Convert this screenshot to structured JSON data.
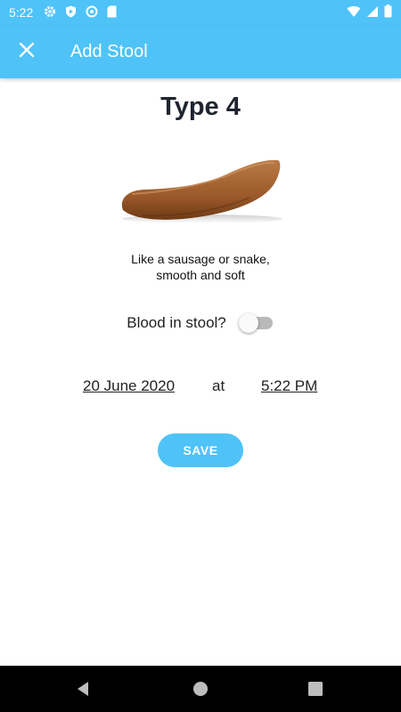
{
  "status_bar": {
    "time": "5:22",
    "icons_left": [
      "settings-icon",
      "play-protect-icon",
      "at-sign-icon",
      "sd-card-icon"
    ],
    "icons_right": [
      "wifi-icon",
      "signal-icon",
      "battery-icon"
    ]
  },
  "app_bar": {
    "title": "Add Stool",
    "close_icon": "close-icon"
  },
  "stool": {
    "type_title": "Type 4",
    "image": "stool-type-4-illustration",
    "description_line1": "Like a sausage or snake,",
    "description_line2": "smooth and soft"
  },
  "blood": {
    "label": "Blood in stool?",
    "enabled": false
  },
  "datetime": {
    "date": "20 June 2020",
    "at": "at",
    "time": "5:22 PM"
  },
  "actions": {
    "save_label": "SAVE"
  },
  "colors": {
    "primary": "#4fc3f7",
    "stool_brown": "#a0612f"
  },
  "nav_bar": {
    "buttons": [
      "back-icon",
      "home-icon",
      "recents-icon"
    ]
  }
}
